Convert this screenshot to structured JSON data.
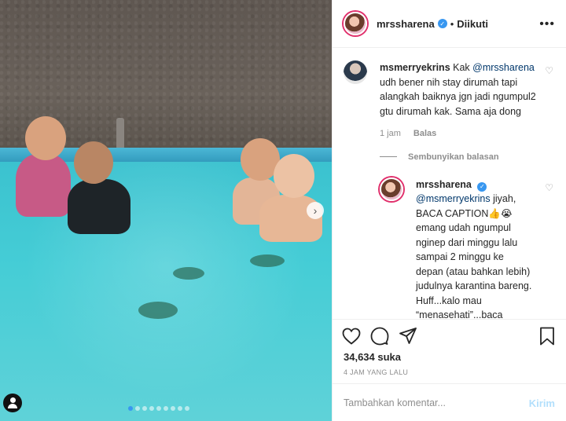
{
  "header": {
    "username": "mrssharena",
    "separator": "•",
    "follow_state": "Diikuti",
    "more_icon": "ellipsis-icon"
  },
  "photo": {
    "slide_count": 9,
    "active_slide": 1,
    "next_icon": "chevron-right-icon",
    "user_tag_icon": "user-tag-icon"
  },
  "comments": {
    "main": {
      "username": "msmerryekrins",
      "prefix": "Kak ",
      "mention": "@mrssharena",
      "text": " udh bener nih stay dirumah tapi alangkah baiknya jgn jadi ngumpul2 gtu dirumah kak. Sama aja dong",
      "time": "1 jam",
      "reply_label": "Balas"
    },
    "hide_replies": "Sembunyikan balasan",
    "reply": {
      "username": "mrssharena",
      "mention": "@msmerryekrins",
      "text": " jiyah, BACA CAPTION👍😭 emang udah ngumpul nginep dari minggu lalu sampai 2 minggu ke depan (atau bahkan lebih) judulnya karantina bareng. Huff...kalo mau “menasehati”...baca"
    }
  },
  "actions": {
    "likes": "34,634 suka",
    "timestamp": "4 JAM YANG LALU",
    "comment_placeholder": "Tambahkan komentar...",
    "post_label": "Kirim"
  },
  "colors": {
    "accent": "#3897f0",
    "post_disabled": "#b2dffc",
    "muted": "#8e8e8e"
  }
}
